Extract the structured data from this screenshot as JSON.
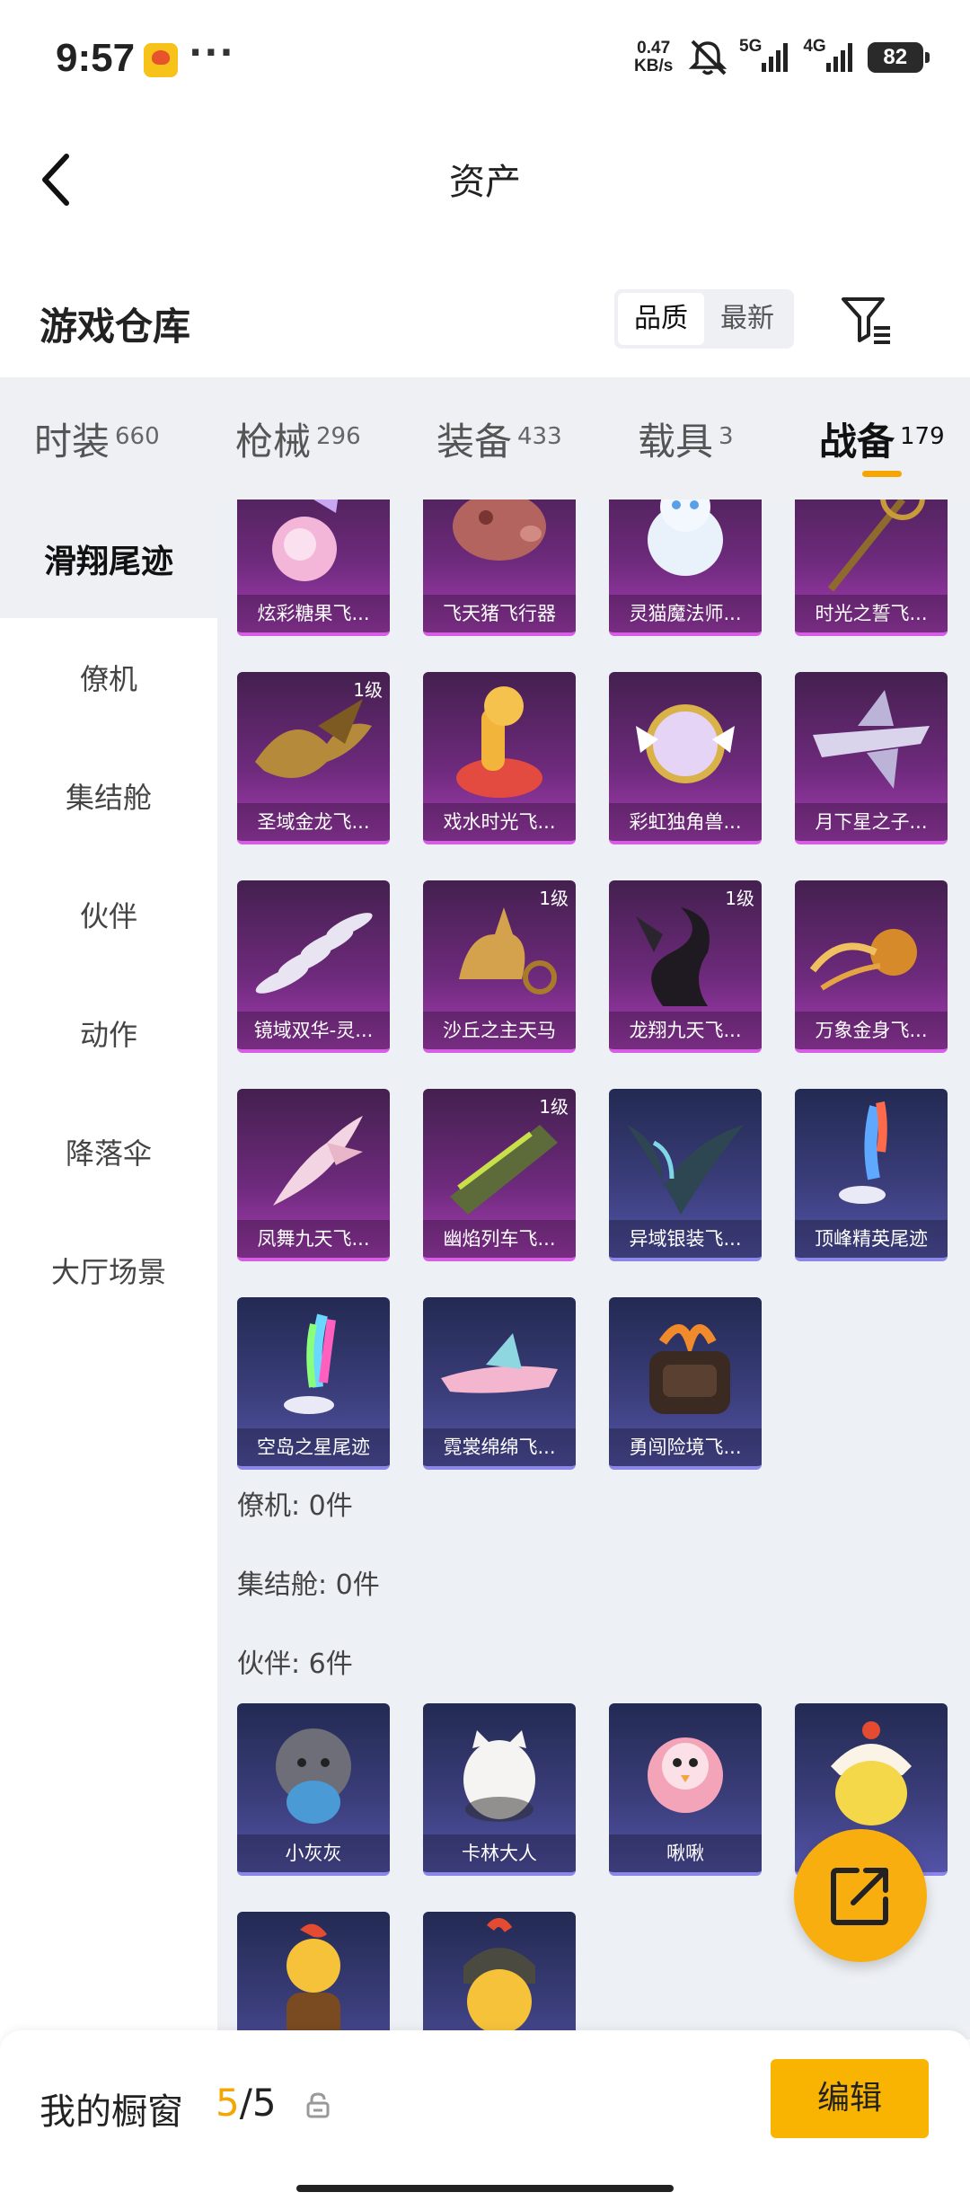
{
  "status_bar": {
    "time": "9:57",
    "more": "···",
    "speed_value": "0.47",
    "speed_unit": "KB/s",
    "sig1": "5G",
    "sig2": "4G",
    "battery": "82"
  },
  "header": {
    "title": "资产"
  },
  "warehouse": {
    "title": "游戏仓库",
    "sort_options": [
      "品质",
      "最新"
    ],
    "sort_active": "品质"
  },
  "tabs": [
    {
      "label": "时装",
      "count": "660"
    },
    {
      "label": "枪械",
      "count": "296"
    },
    {
      "label": "装备",
      "count": "433"
    },
    {
      "label": "载具",
      "count": "3"
    },
    {
      "label": "战备",
      "count": "179",
      "active": true
    }
  ],
  "sidebar": [
    {
      "label": "滑翔尾迹",
      "active": true
    },
    {
      "label": "僚机"
    },
    {
      "label": "集结舱"
    },
    {
      "label": "伙伴"
    },
    {
      "label": "动作"
    },
    {
      "label": "降落伞"
    },
    {
      "label": "大厅场景"
    }
  ],
  "glide_items": [
    {
      "name": "炫彩糖果飞...",
      "rarity": "purple",
      "icon": "candy-glider-icon"
    },
    {
      "name": "飞天猪飞行器",
      "rarity": "purple",
      "icon": "flying-pig-icon"
    },
    {
      "name": "灵猫魔法师...",
      "rarity": "purple",
      "icon": "magic-cat-icon"
    },
    {
      "name": "时光之誓飞...",
      "rarity": "purple",
      "icon": "time-scepter-icon"
    },
    {
      "name": "圣域金龙飞...",
      "rarity": "purple",
      "icon": "golden-dragon-icon",
      "level": "1级"
    },
    {
      "name": "戏水时光飞...",
      "rarity": "purple",
      "icon": "giraffe-float-icon"
    },
    {
      "name": "彩虹独角兽...",
      "rarity": "purple",
      "icon": "unicorn-mirror-icon"
    },
    {
      "name": "月下星之子...",
      "rarity": "purple",
      "icon": "star-jet-icon"
    },
    {
      "name": "镜域双华-灵...",
      "rarity": "purple",
      "icon": "crystal-wings-icon"
    },
    {
      "name": "沙丘之主天马",
      "rarity": "purple",
      "icon": "pegasus-chariot-icon",
      "level": "1级"
    },
    {
      "name": "龙翔九天飞...",
      "rarity": "purple",
      "icon": "black-dragon-icon",
      "level": "1级"
    },
    {
      "name": "万象金身飞...",
      "rarity": "purple",
      "icon": "golden-comet-icon"
    },
    {
      "name": "凤舞九天飞...",
      "rarity": "purple",
      "icon": "phoenix-icon"
    },
    {
      "name": "幽焰列车飞...",
      "rarity": "purple",
      "icon": "phantom-train-icon",
      "level": "1级"
    },
    {
      "name": "异域银装飞...",
      "rarity": "blue",
      "icon": "silver-wings-icon"
    },
    {
      "name": "顶峰精英尾迹",
      "rarity": "blue",
      "icon": "elite-trail-icon"
    },
    {
      "name": "空岛之星尾迹",
      "rarity": "blue",
      "icon": "rainbow-trail-icon"
    },
    {
      "name": "霓裳绵绵飞...",
      "rarity": "blue",
      "icon": "pink-plane-icon"
    },
    {
      "name": "勇闯险境飞...",
      "rarity": "blue",
      "icon": "rocket-pack-icon"
    }
  ],
  "sections": {
    "wingman": "僚机: 0件",
    "pod": "集结舱: 0件",
    "partner": "伙伴: 6件"
  },
  "partner_items": [
    {
      "name": "小灰灰",
      "rarity": "blue",
      "icon": "grey-sheep-icon"
    },
    {
      "name": "卡林大人",
      "rarity": "blue",
      "icon": "white-cat-icon"
    },
    {
      "name": "啾啾",
      "rarity": "blue",
      "icon": "pink-bird-icon"
    },
    {
      "name": "",
      "rarity": "blue",
      "icon": "yellow-chick-icon"
    },
    {
      "name": "",
      "rarity": "blue",
      "icon": "rooster-icon"
    },
    {
      "name": "",
      "rarity": "blue",
      "icon": "helmet-chick-icon"
    }
  ],
  "bottom_bar": {
    "window_label": "我的橱窗",
    "window_current": "5",
    "window_total": "/5",
    "edit_label": "编辑"
  },
  "colors": {
    "accent": "#f8b400",
    "purple_rarity": "#d65ee6",
    "blue_rarity": "#8b86e8",
    "tab_bg": "#eef0f4",
    "content_bg": "#edf0f4"
  }
}
